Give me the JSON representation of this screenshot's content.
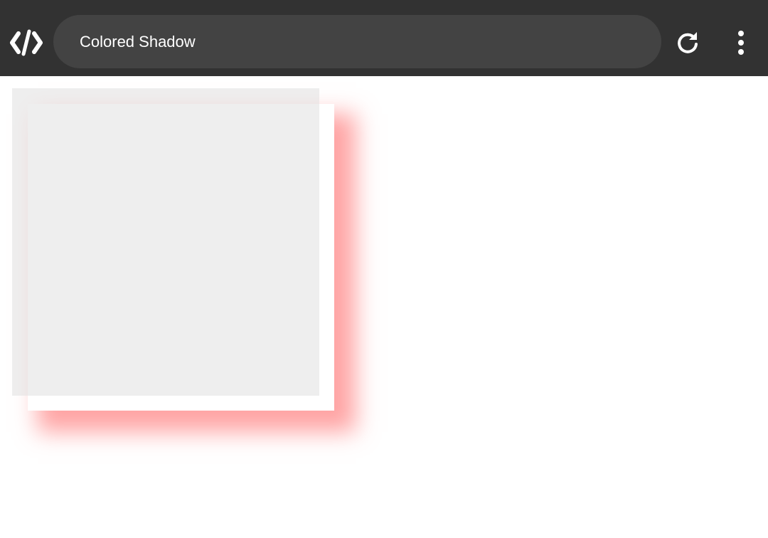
{
  "toolbar": {
    "title": "Colored Shadow",
    "icons": {
      "app": "code-brackets-icon",
      "reload": "reload-icon",
      "menu": "more-vertical-icon"
    },
    "colors": {
      "bar": "#323232",
      "pill": "#434343",
      "text": "#ffffff"
    }
  },
  "demo": {
    "shadow_color": "#ff5a5a",
    "box_color": "#ffffff",
    "overlay_color": "#e0e0e0"
  }
}
